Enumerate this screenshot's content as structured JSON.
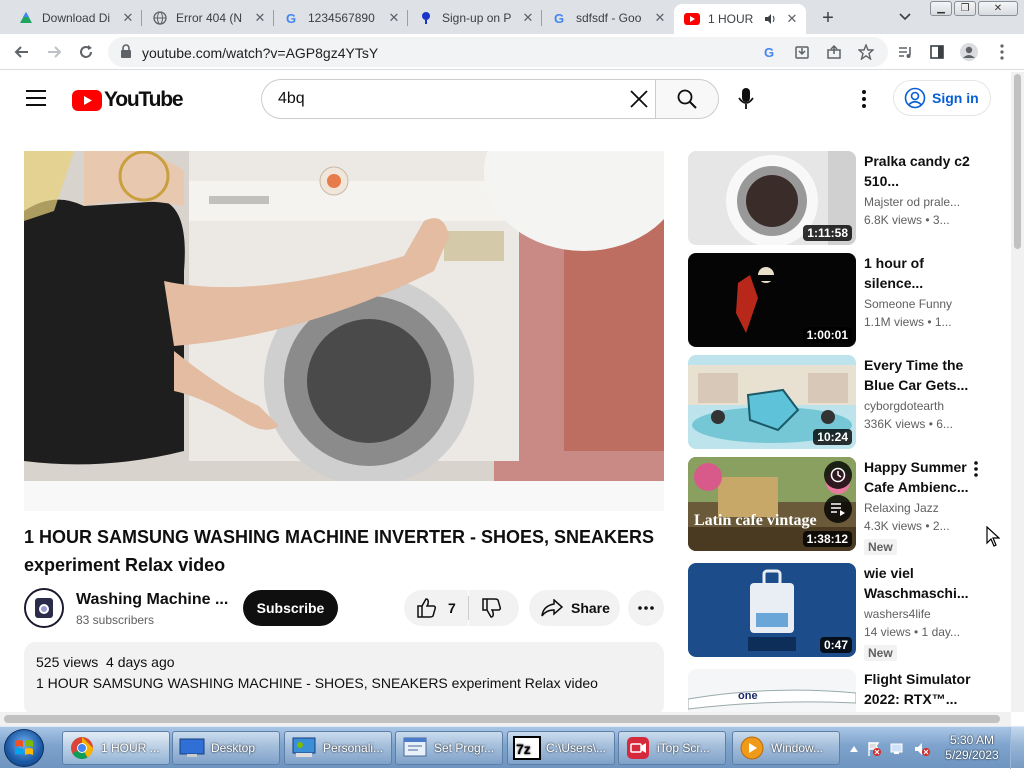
{
  "browser": {
    "tabs": [
      {
        "label": "Download Di",
        "icon": "drive-icon"
      },
      {
        "label": "Error 404 (N",
        "icon": "globe-icon"
      },
      {
        "label": "1234567890",
        "icon": "google-icon"
      },
      {
        "label": "Sign-up on P",
        "icon": "signup-icon"
      },
      {
        "label": "sdfsdf - Goo",
        "icon": "google-icon"
      },
      {
        "label": "1 HOUR",
        "icon": "youtube-icon",
        "active": true
      }
    ],
    "url": "youtube.com/watch?v=AGP8gz4YTsY"
  },
  "youtube": {
    "logo_text": "YouTube",
    "search_query": "4bq",
    "signin_label": "Sign in",
    "video": {
      "title": "1 HOUR SAMSUNG WASHING MACHINE INVERTER - SHOES, SNEAKERS experiment Relax video",
      "channel": "Washing Machine ...",
      "subscribers": "83 subscribers",
      "subscribe_label": "Subscribe",
      "likes": "7",
      "share_label": "Share",
      "views": "525 views",
      "age": "4 days ago",
      "description": "1 HOUR SAMSUNG WASHING MACHINE - SHOES, SNEAKERS experiment Relax video"
    },
    "recommendations": [
      {
        "title": "Pralka candy c2 510...",
        "channel": "Majster od prale...",
        "meta": "6.8K views  • 3...",
        "duration": "1:11:58",
        "badge": ""
      },
      {
        "title": "1 hour of silence...",
        "channel": "Someone Funny",
        "meta": "1.1M views  • 1...",
        "duration": "1:00:01",
        "badge": ""
      },
      {
        "title": "Every Time the Blue Car Gets...",
        "channel": "cyborgdotearth",
        "meta": "336K views  • 6...",
        "duration": "10:24",
        "badge": ""
      },
      {
        "title": "Happy Summer Cafe Ambienc...",
        "channel": "Relaxing Jazz",
        "meta": "4.3K views  • 2...",
        "duration": "1:38:12",
        "badge": "New",
        "thumb_text": "Latin cafe vintage"
      },
      {
        "title": "wie viel Waschmaschi...",
        "channel": "washers4life",
        "meta": "14 views  • 1 day...",
        "duration": "0:47",
        "badge": "New"
      },
      {
        "title": "Flight Simulator 2022: RTX™...",
        "channel": "",
        "meta": "",
        "duration": "",
        "badge": ""
      }
    ]
  },
  "taskbar": {
    "items": [
      {
        "label": "1 HOUR ...",
        "icon": "chrome-icon",
        "active": true
      },
      {
        "label": "Desktop",
        "icon": "desktop-icon"
      },
      {
        "label": "Personali...",
        "icon": "personalize-icon"
      },
      {
        "label": "Set Progr...",
        "icon": "programs-icon"
      },
      {
        "label": "C:\\Users\\...",
        "icon": "7zip-icon"
      },
      {
        "label": "iTop Scr...",
        "icon": "itop-icon"
      },
      {
        "label": "Window...",
        "icon": "media-player-icon"
      }
    ],
    "time": "5:30 AM",
    "date": "5/29/2023"
  }
}
